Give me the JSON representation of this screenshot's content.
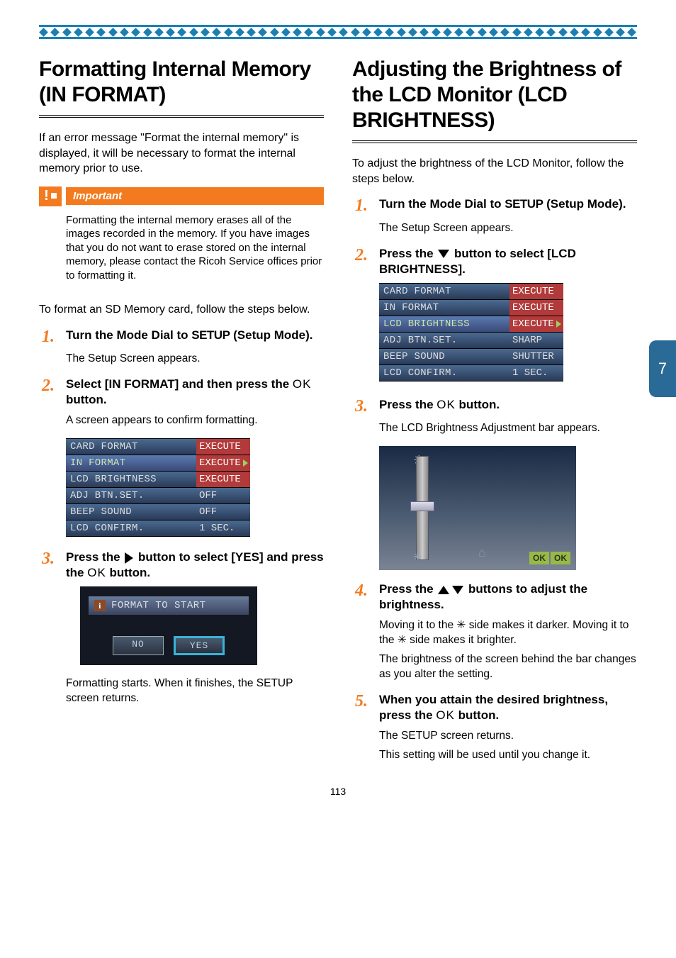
{
  "chapter_tab": "7",
  "page_number": "113",
  "left": {
    "heading": "Formatting Internal Memory (IN FORMAT)",
    "intro": "If an error message \"Format the internal memory\" is displayed, it will be necessary to format the internal memory prior to use.",
    "important_label": "Important",
    "important_text": "Formatting the internal memory erases all of the images recorded in the memory. If you have images that you do not want to erase stored on the internal memory, please contact the Ricoh Service offices prior to formatting it.",
    "preface": "To format an SD Memory card, follow the steps below.",
    "steps": [
      {
        "num": "1.",
        "title_pre": "Turn the Mode Dial to ",
        "title_setup": "SETUP",
        "title_post": " (Setup Mode).",
        "body": "The Setup Screen appears."
      },
      {
        "num": "2.",
        "title_pre": "Select  [IN FORMAT] and then press the ",
        "title_ok": "OK",
        "title_post": " button.",
        "body": "A screen appears to confirm formatting."
      },
      {
        "num": "3.",
        "title_pre": "Press the ",
        "title_mid": " button to select [YES] and press the ",
        "title_ok": "OK",
        "title_post": " button.",
        "body": "Formatting starts. When it finishes, the SETUP screen returns."
      }
    ],
    "menu": [
      {
        "label": "CARD FORMAT",
        "value": "EXECUTE",
        "red": true
      },
      {
        "label": "IN FORMAT",
        "value": "EXECUTE",
        "red": true,
        "selected": true
      },
      {
        "label": "LCD BRIGHTNESS",
        "value": "EXECUTE",
        "red": true
      },
      {
        "label": "ADJ BTN.SET.",
        "value": "OFF"
      },
      {
        "label": "BEEP SOUND",
        "value": "OFF"
      },
      {
        "label": "LCD CONFIRM.",
        "value": "1 SEC."
      }
    ],
    "dialog": {
      "banner": "FORMAT TO START",
      "no": "NO",
      "yes": "YES"
    }
  },
  "right": {
    "heading": "Adjusting the Brightness of the LCD Monitor (LCD BRIGHTNESS)",
    "intro": "To adjust the brightness of the LCD Monitor, follow the steps below.",
    "steps": [
      {
        "num": "1.",
        "title_pre": "Turn the Mode Dial to ",
        "title_setup": "SETUP",
        "title_post": " (Setup Mode).",
        "body": "The Setup Screen appears."
      },
      {
        "num": "2.",
        "title_pre": "Press the ",
        "title_post": " button to select [LCD BRIGHTNESS]."
      },
      {
        "num": "3.",
        "title_pre": "Press the ",
        "title_ok": "OK",
        "title_post": " button.",
        "body": "The LCD Brightness Adjustment bar appears."
      },
      {
        "num": "4.",
        "title_pre": "Press the ",
        "title_post": " buttons to adjust the brightness.",
        "body1": "Moving it to the  ✳  side makes it darker. Moving it to the  ✳  side makes it brighter.",
        "body2": "The brightness of the screen behind the bar changes as you alter the setting."
      },
      {
        "num": "5.",
        "title_pre": "When you attain the desired brightness, press the ",
        "title_ok": "OK",
        "title_post": " button.",
        "body1": "The SETUP screen returns.",
        "body2": "This setting will be used until you change it."
      }
    ],
    "menu": [
      {
        "label": "CARD FORMAT",
        "value": "EXECUTE",
        "red": true
      },
      {
        "label": "IN FORMAT",
        "value": "EXECUTE",
        "red": true
      },
      {
        "label": "LCD BRIGHTNESS",
        "value": "EXECUTE",
        "red": true,
        "selected": true
      },
      {
        "label": "ADJ BTN.SET.",
        "value": "SHARP"
      },
      {
        "label": "BEEP SOUND",
        "value": "SHUTTER"
      },
      {
        "label": "LCD CONFIRM.",
        "value": "1 SEC."
      }
    ],
    "ok_badge": "OK"
  }
}
